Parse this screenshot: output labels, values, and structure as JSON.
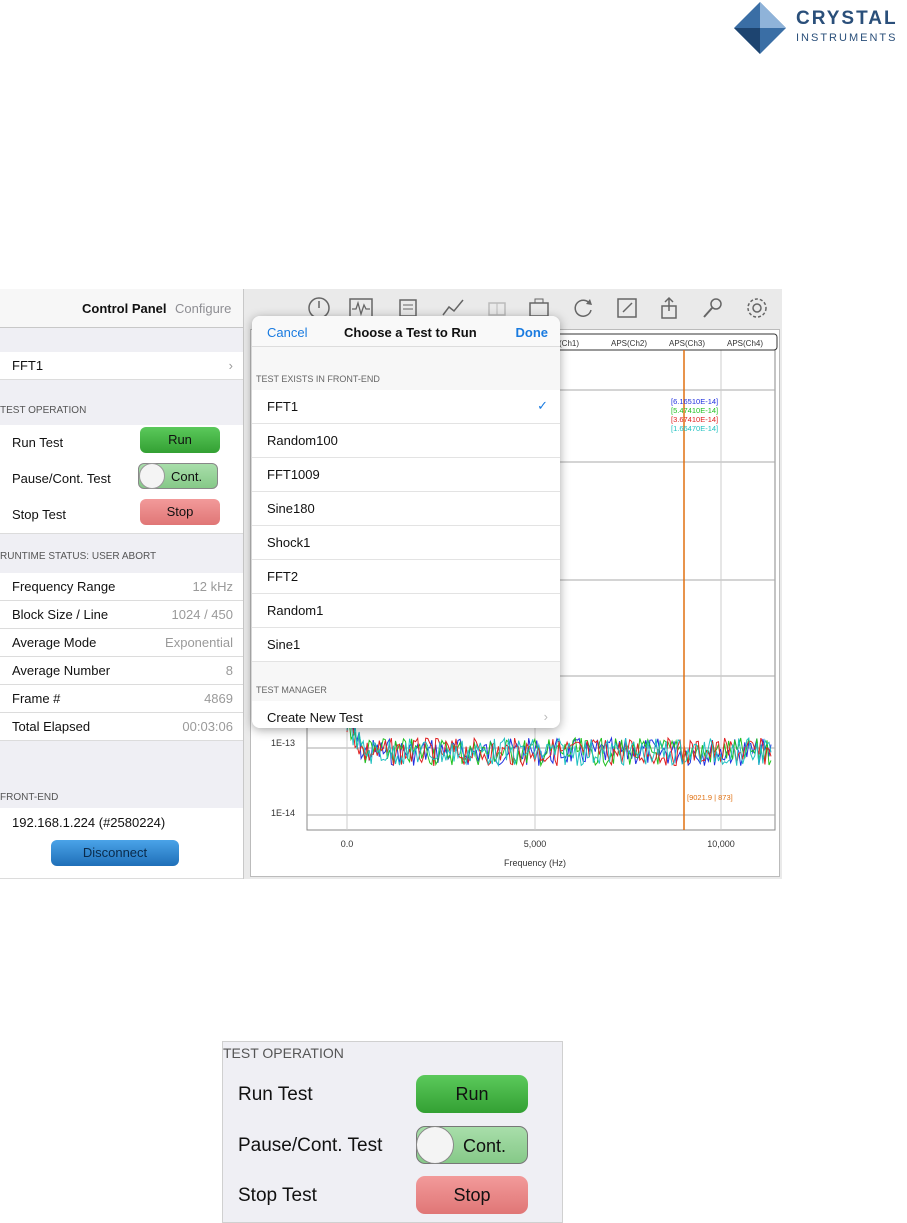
{
  "logo": {
    "line1": "CRYSTAL",
    "line2": "INSTRUMENTS"
  },
  "left_panel": {
    "tab_control": "Control Panel",
    "tab_configure": "Configure",
    "test_name": "FFT1",
    "test_operation_header": "TEST OPERATION",
    "run_label": "Run Test",
    "run_button": "Run",
    "pause_label": "Pause/Cont. Test",
    "pause_toggle": "Cont.",
    "stop_label": "Stop Test",
    "stop_button": "Stop",
    "runtime_header": "RUNTIME STATUS: USER ABORT",
    "status_rows": [
      {
        "label": "Frequency Range",
        "value": "12 kHz"
      },
      {
        "label": "Block Size / Line",
        "value": "1024 / 450"
      },
      {
        "label": "Average Mode",
        "value": "Exponential"
      },
      {
        "label": "Average Number",
        "value": "8"
      },
      {
        "label": "Frame #",
        "value": "4869"
      },
      {
        "label": "Total Elapsed",
        "value": "00:03:06"
      }
    ],
    "frontend_header": "FRONT-END",
    "frontend_ip": "192.168.1.224 (#2580224)",
    "disconnect_button": "Disconnect"
  },
  "toolbar": {
    "icons": [
      "gauge-icon",
      "waveform-icon",
      "report-icon",
      "trend-icon",
      "layout-icon",
      "window-icon",
      "refresh-icon",
      "note-icon",
      "share-icon",
      "search-icon",
      "settings-icon"
    ]
  },
  "chart_data": {
    "type": "line",
    "legend": [
      "(Ch1)",
      "APS(Ch2)",
      "APS(Ch3)",
      "APS(Ch4)"
    ],
    "xlabel": "Frequency (Hz)",
    "x_ticks": [
      "0.0",
      "5,000",
      "10,000"
    ],
    "y_ticks": [
      "1E-13",
      "1E-14"
    ],
    "cursor_values": [
      "[6.16510E-14]",
      "[5.47410E-14]",
      "[3.67410E-14]",
      "[1.66470E-14]"
    ],
    "cursor_x": "[9021.9 | 873]",
    "series_colors": [
      "#2030e0",
      "#20c020",
      "#e02020",
      "#20c0c0"
    ],
    "cursor_color": "#e07010"
  },
  "popover": {
    "cancel": "Cancel",
    "title": "Choose a Test to Run",
    "done": "Done",
    "section1": "TEST EXISTS IN FRONT-END",
    "items": [
      "FFT1",
      "Random100",
      "FFT1009",
      "Sine180",
      "Shock1",
      "FFT2",
      "Random1",
      "Sine1"
    ],
    "checked": "FFT1",
    "section2": "TEST MANAGER",
    "create": "Create New Test"
  },
  "zoom": {
    "header": "TEST OPERATION",
    "run_label": "Run Test",
    "run_button": "Run",
    "pause_label": "Pause/Cont. Test",
    "pause_toggle": "Cont.",
    "stop_label": "Stop Test",
    "stop_button": "Stop"
  }
}
